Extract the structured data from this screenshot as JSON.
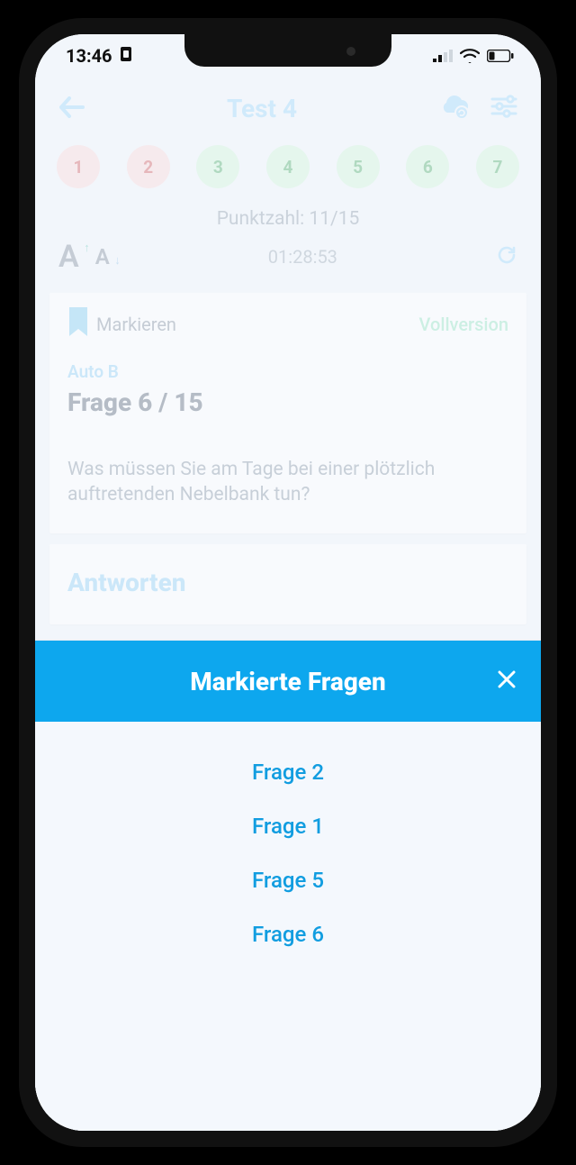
{
  "status": {
    "time": "13:46"
  },
  "header": {
    "title": "Test 4"
  },
  "chips": [
    {
      "num": "1",
      "cls": "red"
    },
    {
      "num": "2",
      "cls": "red"
    },
    {
      "num": "3",
      "cls": "green"
    },
    {
      "num": "4",
      "cls": "green"
    },
    {
      "num": "5",
      "cls": "green"
    },
    {
      "num": "6",
      "cls": "green"
    },
    {
      "num": "7",
      "cls": "green"
    }
  ],
  "score_line": "Punktzahl: 11/15",
  "timer": "01:28:53",
  "card": {
    "bookmark_label": "Markieren",
    "fullversion": "Vollversion",
    "category": "Auto B",
    "question_number": "Frage 6 / 15",
    "question_text": "Was müssen Sie am Tage bei einer plötzlich auftretenden Nebelbank tun?"
  },
  "answers_title": "Antworten",
  "sheet": {
    "title": "Markierte Fragen",
    "items": [
      "Frage 2",
      "Frage 1",
      "Frage 5",
      "Frage 6"
    ]
  }
}
